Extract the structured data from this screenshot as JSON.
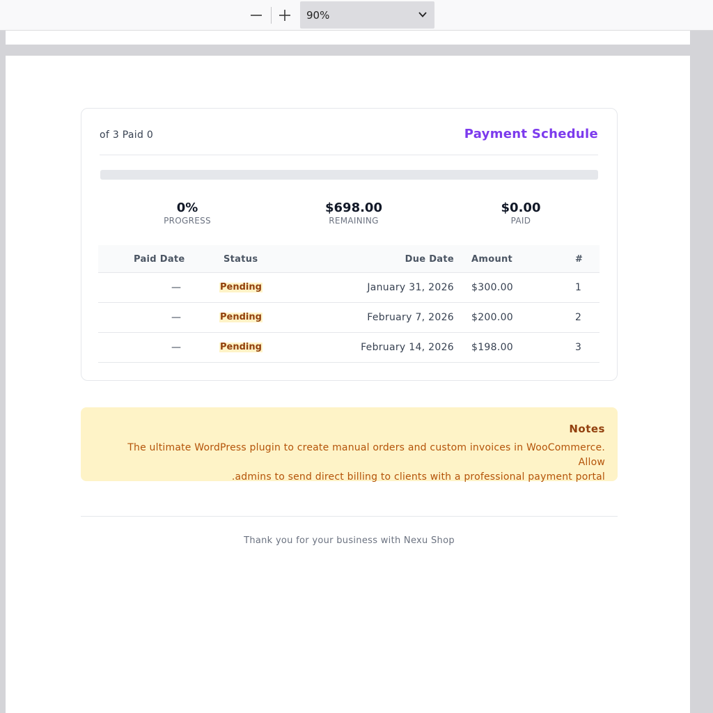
{
  "toolbar": {
    "zoom_value": "90%",
    "zoom_out_icon": "minus-icon",
    "zoom_in_icon": "plus-icon",
    "dropdown_icon": "chevron-down-icon"
  },
  "schedule": {
    "title": "Payment Schedule",
    "count_text": "of 3 Paid 0",
    "progress_fraction": 0,
    "accent_color": "#7c3aed",
    "stats": [
      {
        "value": "0%",
        "label": "PROGRESS"
      },
      {
        "value": "$698.00",
        "label": "REMAINING"
      },
      {
        "value": "$0.00",
        "label": "PAID"
      }
    ],
    "columns": {
      "paid_date": "Paid Date",
      "status": "Status",
      "due_date": "Due Date",
      "amount": "Amount",
      "number": "#"
    },
    "rows": [
      {
        "paid_date": "—",
        "status": "Pending",
        "due_date": "January 31, 2026",
        "amount": "$300.00",
        "number": "1"
      },
      {
        "paid_date": "—",
        "status": "Pending",
        "due_date": "February 7, 2026",
        "amount": "$200.00",
        "number": "2"
      },
      {
        "paid_date": "—",
        "status": "Pending",
        "due_date": "February 14, 2026",
        "amount": "$198.00",
        "number": "3"
      }
    ]
  },
  "notes": {
    "title": "Notes",
    "line1": "The ultimate WordPress plugin to create manual orders and custom invoices in WooCommerce. Allow",
    "line2": ".admins to send direct billing to clients with a professional payment portal"
  },
  "footer": {
    "text": "Thank you for your business with Nexu Shop"
  }
}
